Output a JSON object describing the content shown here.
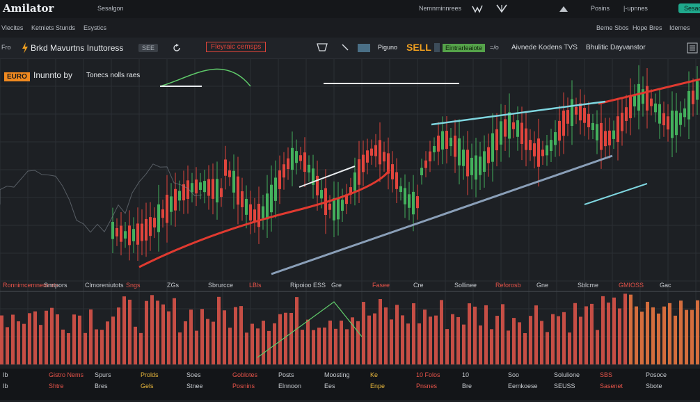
{
  "app": {
    "logo": "Amilator",
    "search_label": "Sesalgon",
    "top_center": "Nemnminnrees",
    "top_right_label": "Posins",
    "top_right_menu": "|-upnnes",
    "top_right_button": "Sesaon"
  },
  "nav": {
    "left_items": [
      "Viecites",
      "Ketniets Stunds",
      "Esystics"
    ],
    "right_items": [
      "Beme Sbos",
      "Hope Bres",
      "Idemes"
    ]
  },
  "toolbar": {
    "symbol": "Fro",
    "title": "Brkd Mavurtns Inuttoress",
    "interval_badge": "SEE",
    "indicator_label": "Fleyraic cemsps",
    "pair_label": "Piguno",
    "sell_label": "SELL",
    "green_tag": "Eintrarleaiote",
    "right_dash": "=/o",
    "right_text": "Aivnede Kodens TVS",
    "right_text2": "Bhulitic Dayvanstor"
  },
  "chart": {
    "ticker_badge": "EURO",
    "subtitle": "Inunnto by",
    "subtitle2": "Tonecs nolls raes",
    "axis_row": [
      "Ronnimcemnemmts",
      "Snnpors",
      "Clmoreniutots",
      "Sngs",
      "ZGs",
      "Sbrurcce",
      "LBls",
      "Ripoioo ESS",
      "Gre",
      "Fasee",
      "Cre",
      "Sollinee",
      "Reforosb",
      "Gne",
      "Sblcme",
      "GMIOSS",
      "Gac"
    ],
    "colors": {
      "bull": "#43b05c",
      "bear": "#e0453d",
      "volume": "#e4574b",
      "volume_bright": "#f47b42",
      "trend_red": "#e03a30",
      "trend_cyan": "#7fd6e0",
      "trend_green": "#5fc96a",
      "background": "#1d2024"
    }
  },
  "bottom": {
    "row1": [
      "Ib",
      "Gistro Nems",
      "Spurs",
      "Prolds",
      "Soes",
      "Goblotes",
      "Posts",
      "Moosting",
      "Ke",
      "10 Folos",
      "10",
      "Soo",
      "Solulione",
      "SBS",
      "Posoce"
    ],
    "row2": [
      "Ib",
      "Shtre",
      "Bres",
      "Gels",
      "Stnee",
      "Posnins",
      "Elnnoon",
      "Ees",
      "Enpe",
      "Pnsnes",
      "Bre",
      "Eemkoese",
      "SEUSS",
      "Sasenet",
      "Sbote"
    ]
  }
}
